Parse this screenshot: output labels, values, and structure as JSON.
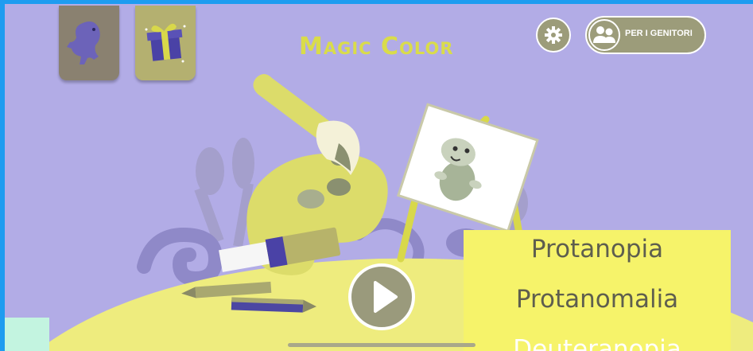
{
  "app": {
    "title": "Magic Color",
    "parents_label": "PER I GENITORI"
  },
  "icons": {
    "character_tile": "dinosaur-icon",
    "gift_tile": "gift-icon",
    "settings": "gear-icon",
    "parents": "people-icon",
    "play": "play-icon"
  },
  "colorblind_menu": {
    "options": [
      "Protanopia",
      "Protanomalia",
      "Deuteranopia"
    ]
  },
  "colors": {
    "background": "#b2ace6",
    "accent_yellow": "#f6f36a",
    "title": "#d9dc4a",
    "frame": "#1e9cf0"
  }
}
